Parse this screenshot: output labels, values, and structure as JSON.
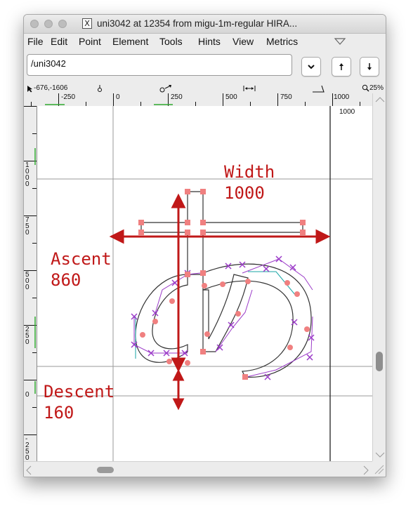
{
  "window": {
    "title": "uni3042 at 12354 from migu-1m-regular HIRA..."
  },
  "menubar": {
    "items": [
      "File",
      "Edit",
      "Point",
      "Element",
      "Tools",
      "Hints",
      "View",
      "Metrics"
    ]
  },
  "glyph_field": {
    "value": "/uni3042"
  },
  "infobar": {
    "coords": "-676,-1606",
    "zoom": "25%"
  },
  "rulers": {
    "horizontal": [
      "-250",
      "0",
      "250",
      "500",
      "750",
      "1000"
    ],
    "vertical": [
      "1000",
      "750",
      "500",
      "250",
      "0",
      "-250"
    ]
  },
  "canvas": {
    "width_label": "1000"
  },
  "annotations": {
    "width": {
      "title": "Width",
      "value": "1000"
    },
    "ascent": {
      "title": "Ascent",
      "value": "860"
    },
    "descent": {
      "title": "Descent",
      "value": "160"
    }
  },
  "colors": {
    "annotation": "#c01818",
    "outline": "#333333",
    "control_point": "#9b3bc8",
    "on_curve_point": "#f08080"
  }
}
